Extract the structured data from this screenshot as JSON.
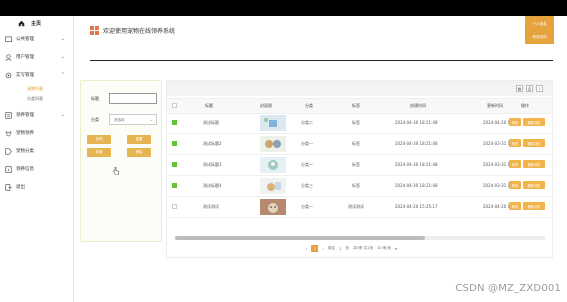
{
  "sidebar": {
    "home_label": "主页",
    "items": [
      {
        "label": "公共管理"
      },
      {
        "label": "用户管理"
      },
      {
        "label": "实写管理"
      },
      {
        "label": "领养管理"
      },
      {
        "label": "宠物领养"
      },
      {
        "label": "宠物分类"
      },
      {
        "label": "领养信息"
      },
      {
        "label": "退出"
      }
    ],
    "sub_items": [
      {
        "label": "宠物列表"
      },
      {
        "label": "分类列表"
      }
    ]
  },
  "header": {
    "title": "欢迎使用宠物在线领养系统",
    "user_panel_line1": "个人信息",
    "user_panel_line2": "修改密码"
  },
  "search": {
    "title_label": "标题",
    "category_label": "分类",
    "category_value": "请选择",
    "btn_search": "查询",
    "btn_reset": "重置",
    "btn_add": "新增",
    "btn_delete": "删除"
  },
  "table": {
    "columns": [
      "标题",
      "封面图",
      "分类",
      "标签",
      "创建时间",
      "更新时间",
      "操作"
    ],
    "rows": [
      {
        "title": "测试标题",
        "category": "分类二",
        "tag": "标签",
        "created": "2024-04-30 18:21:48",
        "updated": "2024-04-20 1",
        "checked": true
      },
      {
        "title": "测试标题2",
        "category": "分类一",
        "tag": "标签",
        "created": "2024-04-30 18:21:48",
        "updated": "2024-03-31 1",
        "checked": true
      },
      {
        "title": "测试标题3",
        "category": "分类一",
        "tag": "标签",
        "created": "2024-04-30 18:21:48",
        "updated": "2024-03-31 1",
        "checked": true
      },
      {
        "title": "测试标题4",
        "category": "分类三",
        "tag": "标签",
        "created": "2024-04-30 18:21:48",
        "updated": "2024-03-31 1",
        "checked": true
      },
      {
        "title": "测试测试",
        "category": "分类一",
        "tag": "测试测试",
        "created": "2024-04-20 15:25:17",
        "updated": "2024-04-20 1",
        "checked": false
      }
    ],
    "op_edit": "修改",
    "op_delete": "删除详情"
  },
  "pager": {
    "page_current": "1",
    "page_total": "1",
    "prefix": "前往",
    "suffix": "页",
    "total_text": "共5条 共1页",
    "page_size": "10 条/页"
  },
  "watermark": "CSDN @MZ_ZXD001",
  "colors": {
    "accent": "#e6a23c",
    "check": "#67c23a"
  }
}
